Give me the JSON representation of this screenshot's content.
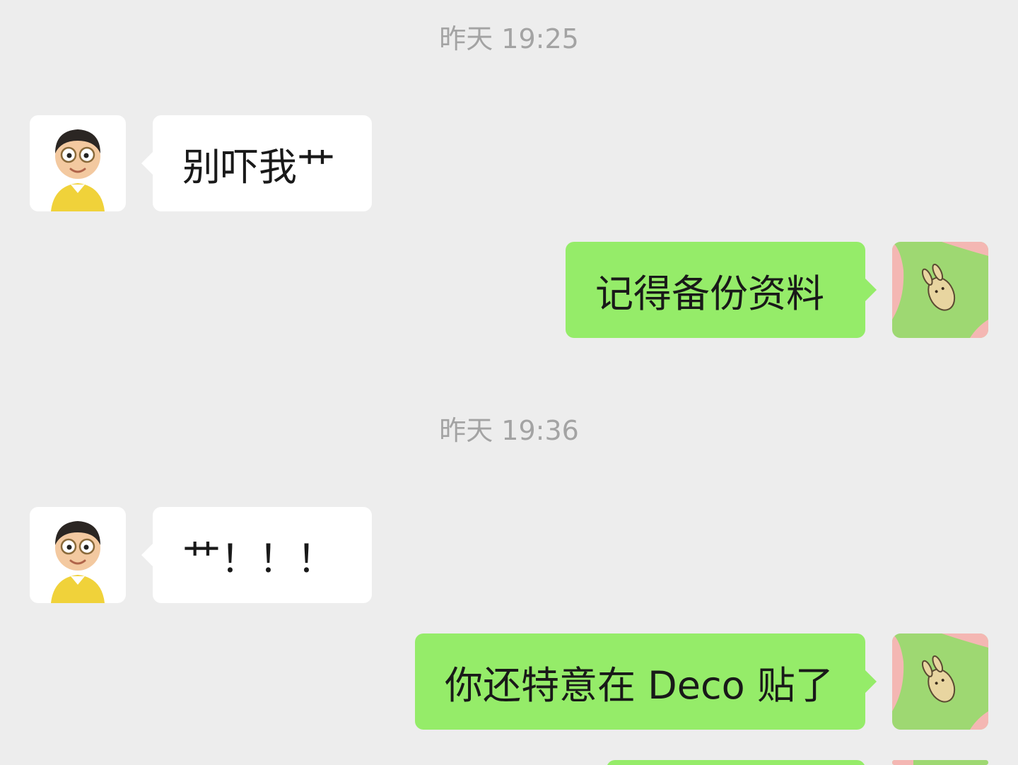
{
  "chat": {
    "timestamps": [
      "昨天 19:25",
      "昨天 19:36"
    ],
    "messages": [
      {
        "direction": "incoming",
        "avatar_icon": "cartoon-boy-avatar-icon",
        "text": "别吓我艹"
      },
      {
        "direction": "outgoing",
        "avatar_icon": "bunny-sticker-avatar-icon",
        "text": "记得备份资料"
      },
      {
        "direction": "incoming",
        "avatar_icon": "cartoon-boy-avatar-icon",
        "text": "艹！！！"
      },
      {
        "direction": "outgoing",
        "avatar_icon": "bunny-sticker-avatar-icon",
        "text": "你还特意在 Deco 贴了"
      }
    ]
  },
  "colors": {
    "background": "#ededed",
    "incoming_bubble": "#ffffff",
    "outgoing_bubble": "#95ec69",
    "timestamp_text": "#a3a3a3",
    "message_text": "#191919"
  }
}
